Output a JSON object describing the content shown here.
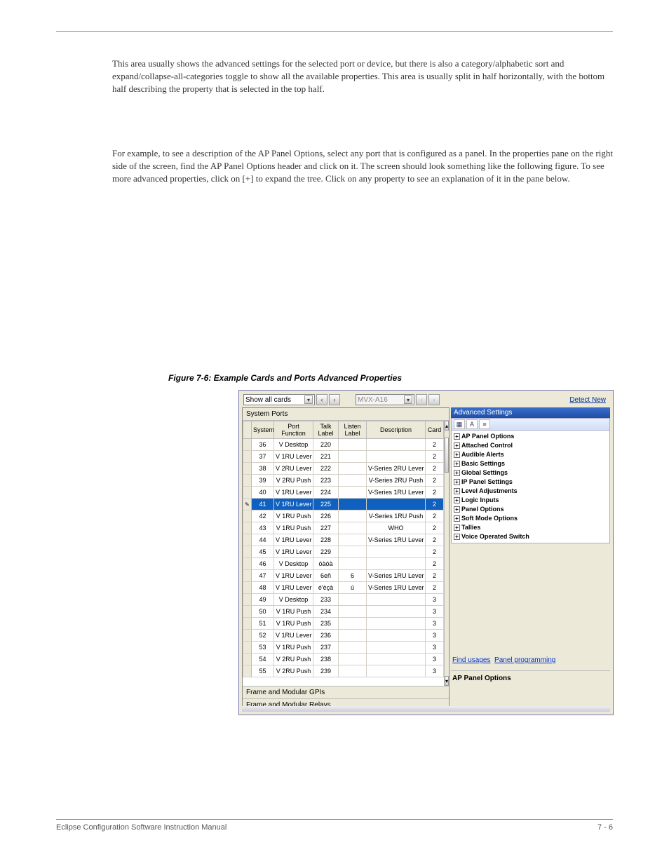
{
  "doc": {
    "paragraphs": [
      "This area usually shows the advanced settings for the selected port or device, but there is also a category/alphabetic sort and expand/collapse-all-categories toggle to show all the available properties. This area is usually split in half horizontally, with the bottom half describing the property that is selected in the top half.",
      "For example, to see a description of the AP Panel Options, select any port that is configured as a panel. In the properties pane on the right side of the screen, find the AP Panel Options header and click on it. The screen should look something like the following figure. To see more advanced properties, click on [+] to expand the tree. Click on any property to see an explanation of it in the pane below."
    ],
    "figure_caption": "Figure 7-6: Example Cards and Ports Advanced Properties",
    "footer_left": "Eclipse Configuration Software Instruction Manual",
    "footer_right": "7 - 6"
  },
  "toolbar": {
    "card_filter": "Show all cards",
    "slot_label": "MVX-A16",
    "detect_new": "Detect New"
  },
  "table": {
    "section_title": "System Ports",
    "headers": [
      "",
      "System",
      "Port Function",
      "Talk Label",
      "Listen Label",
      "Description",
      "Card"
    ],
    "rows": [
      {
        "sys": "36",
        "func": "V Desktop",
        "talk": "220",
        "listen": "",
        "desc": "",
        "card": "2"
      },
      {
        "sys": "37",
        "func": "V 1RU Lever",
        "talk": "221",
        "listen": "",
        "desc": "",
        "card": "2"
      },
      {
        "sys": "38",
        "func": "V 2RU Lever",
        "talk": "222",
        "listen": "",
        "desc": "V-Series 2RU Lever",
        "card": "2"
      },
      {
        "sys": "39",
        "func": "V 2RU Push",
        "talk": "223",
        "listen": "",
        "desc": "V-Series 2RU Push",
        "card": "2"
      },
      {
        "sys": "40",
        "func": "V 1RU Lever",
        "talk": "224",
        "listen": "",
        "desc": "V-Series 1RU Lever",
        "card": "2"
      },
      {
        "sys": "41",
        "func": "V 1RU Lever",
        "talk": "225",
        "listen": "",
        "desc": "",
        "card": "2",
        "selected": true
      },
      {
        "sys": "42",
        "func": "V 1RU Push",
        "talk": "226",
        "listen": "",
        "desc": "V-Series 1RU Push",
        "card": "2"
      },
      {
        "sys": "43",
        "func": "V 1RU Push",
        "talk": "227",
        "listen": "",
        "desc": "WHO",
        "card": "2"
      },
      {
        "sys": "44",
        "func": "V 1RU Lever",
        "talk": "228",
        "listen": "",
        "desc": "V-Series 1RU Lever",
        "card": "2"
      },
      {
        "sys": "45",
        "func": "V 1RU Lever",
        "talk": "229",
        "listen": "",
        "desc": "",
        "card": "2"
      },
      {
        "sys": "46",
        "func": "V Desktop",
        "talk": "óàóà",
        "listen": "",
        "desc": "",
        "card": "2"
      },
      {
        "sys": "47",
        "func": "V 1RU Lever",
        "talk": "6eñ",
        "listen": "6",
        "desc": "V-Series 1RU Lever",
        "card": "2"
      },
      {
        "sys": "48",
        "func": "V 1RU Lever",
        "talk": "é'èçà",
        "listen": "ù",
        "desc": "V-Series 1RU Lever",
        "card": "2"
      },
      {
        "sys": "49",
        "func": "V Desktop",
        "talk": "233",
        "listen": "",
        "desc": "",
        "card": "3"
      },
      {
        "sys": "50",
        "func": "V 1RU Push",
        "talk": "234",
        "listen": "",
        "desc": "",
        "card": "3"
      },
      {
        "sys": "51",
        "func": "V 1RU Push",
        "talk": "235",
        "listen": "",
        "desc": "",
        "card": "3"
      },
      {
        "sys": "52",
        "func": "V 1RU Lever",
        "talk": "236",
        "listen": "",
        "desc": "",
        "card": "3"
      },
      {
        "sys": "53",
        "func": "V 1RU Push",
        "talk": "237",
        "listen": "",
        "desc": "",
        "card": "3"
      },
      {
        "sys": "54",
        "func": "V 2RU Push",
        "talk": "238",
        "listen": "",
        "desc": "",
        "card": "3"
      },
      {
        "sys": "55",
        "func": "V 2RU Push",
        "talk": "239",
        "listen": "",
        "desc": "",
        "card": "3"
      }
    ],
    "footers": [
      "Frame and Modular GPIs",
      "Frame and Modular Relays"
    ]
  },
  "advanced": {
    "title": "Advanced Settings",
    "tree": [
      {
        "label": "AP Panel Options",
        "expandable": true,
        "bold": true
      },
      {
        "label": "Attached Control",
        "expandable": true,
        "bold": true
      },
      {
        "label": "Audible Alerts",
        "expandable": true,
        "bold": true
      },
      {
        "label": "Basic Settings",
        "expandable": true,
        "bold": true
      },
      {
        "label": "Global Settings",
        "expandable": true,
        "bold": true
      },
      {
        "label": "IP Panel Settings",
        "expandable": true,
        "bold": true
      },
      {
        "label": "Level Adjustments",
        "expandable": true,
        "bold": true
      },
      {
        "label": "Logic Inputs",
        "expandable": true,
        "bold": true
      },
      {
        "label": "Panel Options",
        "expandable": true,
        "bold": true
      },
      {
        "label": "Soft Mode Options",
        "expandable": true,
        "bold": true
      },
      {
        "label": "Tallies",
        "expandable": true,
        "bold": true
      },
      {
        "label": "Voice Operated Switch",
        "expandable": true,
        "bold": true
      }
    ],
    "links": {
      "find_usages": "Find usages",
      "panel_programming": "Panel programming"
    },
    "desc_title": "AP Panel Options"
  }
}
